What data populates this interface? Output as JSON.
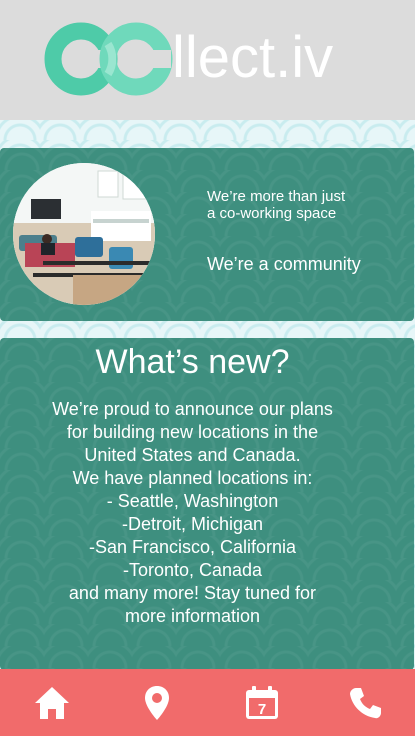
{
  "app": {
    "logo_text": "llect.iv",
    "logo_colors": [
      "#4ecba8",
      "#7ee0c4"
    ]
  },
  "intro": {
    "line1": "We’re more than just",
    "line2": "a co-working space",
    "community": "We’re a community"
  },
  "news": {
    "title": "What’s new?",
    "lines": [
      "We’re proud to announce our plans",
      "for building new locations in the",
      "United States and Canada.",
      "We have planned locations in:",
      "- Seattle, Washington",
      "-Detroit, Michigan",
      "-San Francisco, California",
      "-Toronto, Canada",
      "and many more! Stay tuned for",
      "more information"
    ]
  },
  "nav": {
    "items": [
      {
        "icon": "home-icon"
      },
      {
        "icon": "location-pin-icon"
      },
      {
        "icon": "calendar-icon",
        "day": "7"
      },
      {
        "icon": "phone-icon"
      }
    ],
    "color": "#f16b6b"
  }
}
